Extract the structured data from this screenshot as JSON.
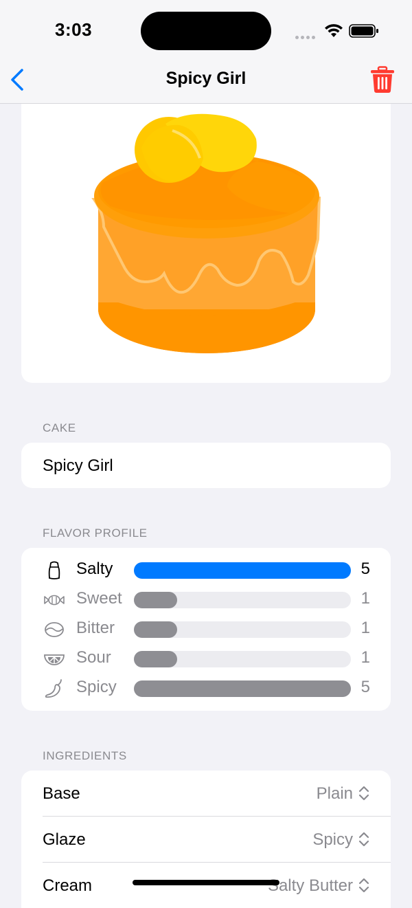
{
  "status": {
    "time": "3:03"
  },
  "nav": {
    "title": "Spicy Girl",
    "back_icon": "chevron-left-icon",
    "trash_icon": "trash-icon"
  },
  "colors": {
    "accent": "#007aff",
    "destructive": "#ff3b30",
    "bar_gray": "#8e8e93",
    "cake_orange": "#ff9f0a"
  },
  "sections": {
    "cake": {
      "header": "CAKE",
      "name": "Spicy Girl"
    },
    "flavor": {
      "header": "FLAVOR PROFILE",
      "items": [
        {
          "label": "Salty",
          "value": "5",
          "level": 1.0,
          "icon": "salt-shaker-icon",
          "highlighted": true
        },
        {
          "label": "Sweet",
          "value": "1",
          "level": 0.2,
          "icon": "candy-icon",
          "highlighted": false
        },
        {
          "label": "Bitter",
          "value": "1",
          "level": 0.2,
          "icon": "coffee-bean-icon",
          "highlighted": false
        },
        {
          "label": "Sour",
          "value": "1",
          "level": 0.2,
          "icon": "citrus-icon",
          "highlighted": false
        },
        {
          "label": "Spicy",
          "value": "5",
          "level": 1.0,
          "icon": "chili-pepper-icon",
          "highlighted": false
        }
      ]
    },
    "ingredients": {
      "header": "INGREDIENTS",
      "rows": [
        {
          "label": "Base",
          "value": "Plain"
        },
        {
          "label": "Glaze",
          "value": "Spicy"
        },
        {
          "label": "Cream",
          "value": "Salty Butter"
        }
      ]
    }
  }
}
